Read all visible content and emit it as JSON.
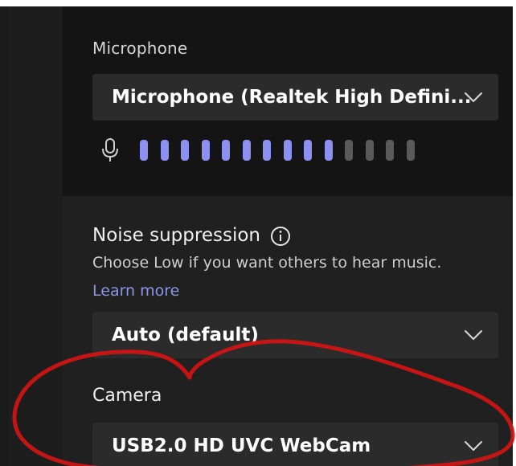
{
  "microphone": {
    "label": "Microphone",
    "selected": "Microphone (Realtek High Defini...",
    "level": {
      "active_bars": 10,
      "total_bars": 14
    },
    "colors": {
      "active": "#8c90f0",
      "inactive": "#5a5a5a"
    }
  },
  "noise_suppression": {
    "label": "Noise suppression",
    "hint": "Choose Low if you want others to hear music.",
    "link": "Learn more",
    "selected": "Auto (default)"
  },
  "camera": {
    "label": "Camera",
    "selected": "USB2.0 HD UVC WebCam"
  },
  "colors": {
    "accent_link": "#8e95e8",
    "annotation_stroke": "#d31414",
    "background": "#1f1f1f"
  },
  "icons": {
    "mic": "mic-icon",
    "chevron": "chevron-down-icon",
    "info": "info-icon"
  }
}
